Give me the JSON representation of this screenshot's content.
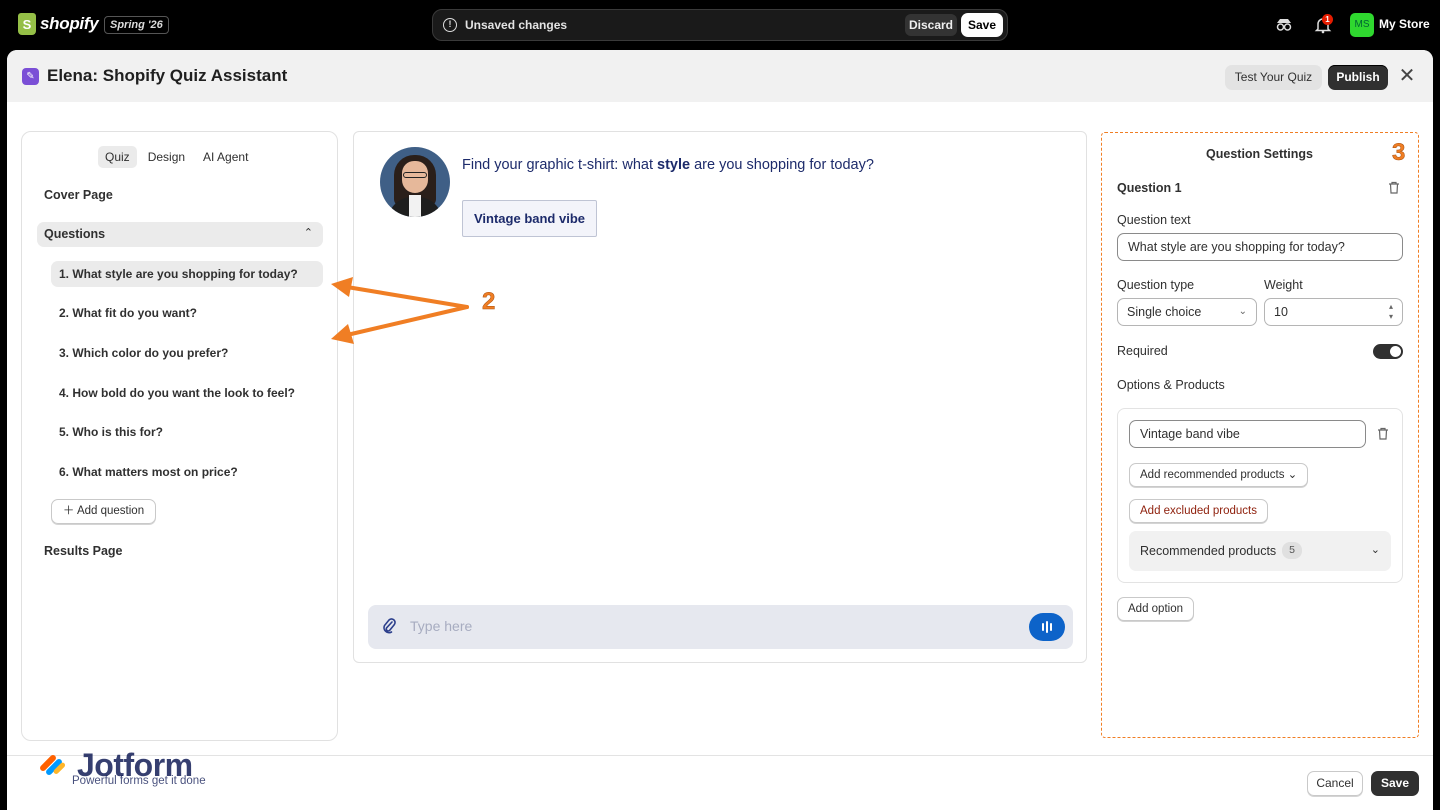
{
  "topbar": {
    "brand": "shopify",
    "brand_icon": "shopping-bag-icon",
    "edition": "Spring '26",
    "unsaved_text": "Unsaved changes",
    "discard_label": "Discard",
    "save_label": "Save",
    "notification_count": "1",
    "store_initials": "MS",
    "store_name": "My Store",
    "colors": {
      "bar": "#000000",
      "logo": "#95bf47",
      "avatar": "#2fd82f"
    }
  },
  "window": {
    "title": "Elena: Shopify Quiz Assistant",
    "test_label": "Test Your Quiz",
    "publish_label": "Publish",
    "close_symbol": "✕"
  },
  "sidebar": {
    "tabs": [
      {
        "label": "Quiz",
        "active": true
      },
      {
        "label": "Design",
        "active": false
      },
      {
        "label": "AI Agent",
        "active": false
      }
    ],
    "cover_page": "Cover Page",
    "questions_label": "Questions",
    "questions": [
      "1. What style are you shopping for today?",
      "2. What fit do you want?",
      "3. Which color do you prefer?",
      "4. How bold do you want the look to feel?",
      "5. Who is this for?",
      "6. What matters most on price?"
    ],
    "add_question": "Add question",
    "results_page": "Results Page"
  },
  "preview": {
    "question_before": "Find your graphic t-shirt: what ",
    "question_bold": "style",
    "question_after": " are you shopping for today?",
    "answer_option": "Vintage band vibe",
    "input_placeholder": "Type here",
    "accent": "#0d63c9"
  },
  "settings": {
    "title": "Question Settings",
    "question_heading": "Question 1",
    "question_text_label": "Question text",
    "question_text_value": "What style are you shopping for today?",
    "question_type_label": "Question type",
    "question_type_value": "Single choice",
    "weight_label": "Weight",
    "weight_value": "10",
    "required_label": "Required",
    "required_on": true,
    "options_label": "Options & Products",
    "option_value": "Vintage band vibe",
    "add_recommended": "Add recommended products",
    "add_excluded": "Add excluded products",
    "recommended_label": "Recommended products",
    "recommended_count": "5",
    "add_option": "Add option"
  },
  "annotations": {
    "step_2": "2",
    "step_3": "3",
    "color": "#f07e24"
  },
  "footer": {
    "brand": "Jotform",
    "tagline": "Powerful forms get it done",
    "cancel_label": "Cancel",
    "save_label": "Save"
  }
}
